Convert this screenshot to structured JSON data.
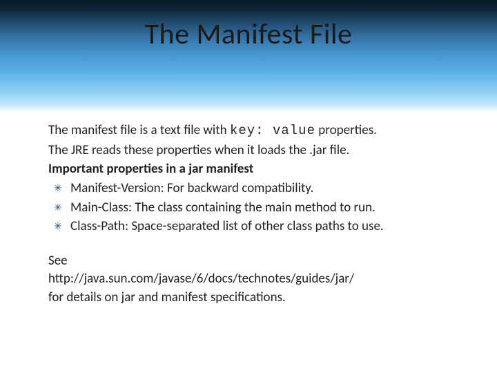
{
  "title": "The Manifest File",
  "intro": {
    "p1_prefix": "The manifest file is a text file with ",
    "p1_mono": "key: value",
    "p1_suffix": " properties.",
    "p2": "The JRE reads these properties when it loads the .jar file.",
    "heading": "Important properties in a jar manifest"
  },
  "bullets": [
    "Manifest-Version: For backward compatibility.",
    "Main-Class: The class containing the main method to run.",
    "Class-Path: Space-separated list of other class paths to use."
  ],
  "footer": {
    "see": "See",
    "url": "http://java.sun.com/javase/6/docs/technotes/guides/jar/",
    "tail": "for details on jar and manifest specifications."
  }
}
